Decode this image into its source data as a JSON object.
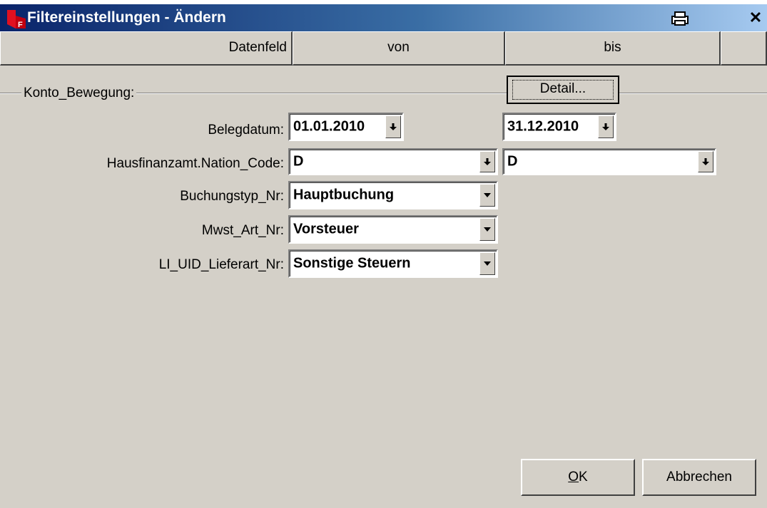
{
  "window": {
    "title": "Filtereinstellungen - Ändern"
  },
  "header": {
    "col_field": "Datenfeld",
    "col_from": "von",
    "col_to": "bis"
  },
  "group": {
    "label": "Konto_Bewegung:"
  },
  "buttons": {
    "detail": "Detail...",
    "ok_mnemonic": "O",
    "ok_rest": "K",
    "cancel": "Abbrechen"
  },
  "fields": {
    "belegdatum": {
      "label": "Belegdatum:",
      "from": "01.01.2010",
      "to": "31.12.2010"
    },
    "nation_code": {
      "label": "Hausfinanzamt.Nation_Code:",
      "from": "D",
      "to": "D"
    },
    "buchungstyp": {
      "label": "Buchungstyp_Nr:",
      "value": "Hauptbuchung"
    },
    "mwst_art": {
      "label": "Mwst_Art_Nr:",
      "value": "Vorsteuer"
    },
    "lieferart": {
      "label": "LI_UID_Lieferart_Nr:",
      "value": "Sonstige Steuern"
    }
  },
  "colors": {
    "titlebar_start": "#0a246a",
    "titlebar_end": "#a6caf0",
    "dialog_bg": "#d4d0c8"
  },
  "icons": {
    "app": "app-logo-icon",
    "print": "printer-icon",
    "close": "close-icon",
    "spin": "small-down-arrow-icon",
    "combo": "combo-down-arrow-icon"
  }
}
